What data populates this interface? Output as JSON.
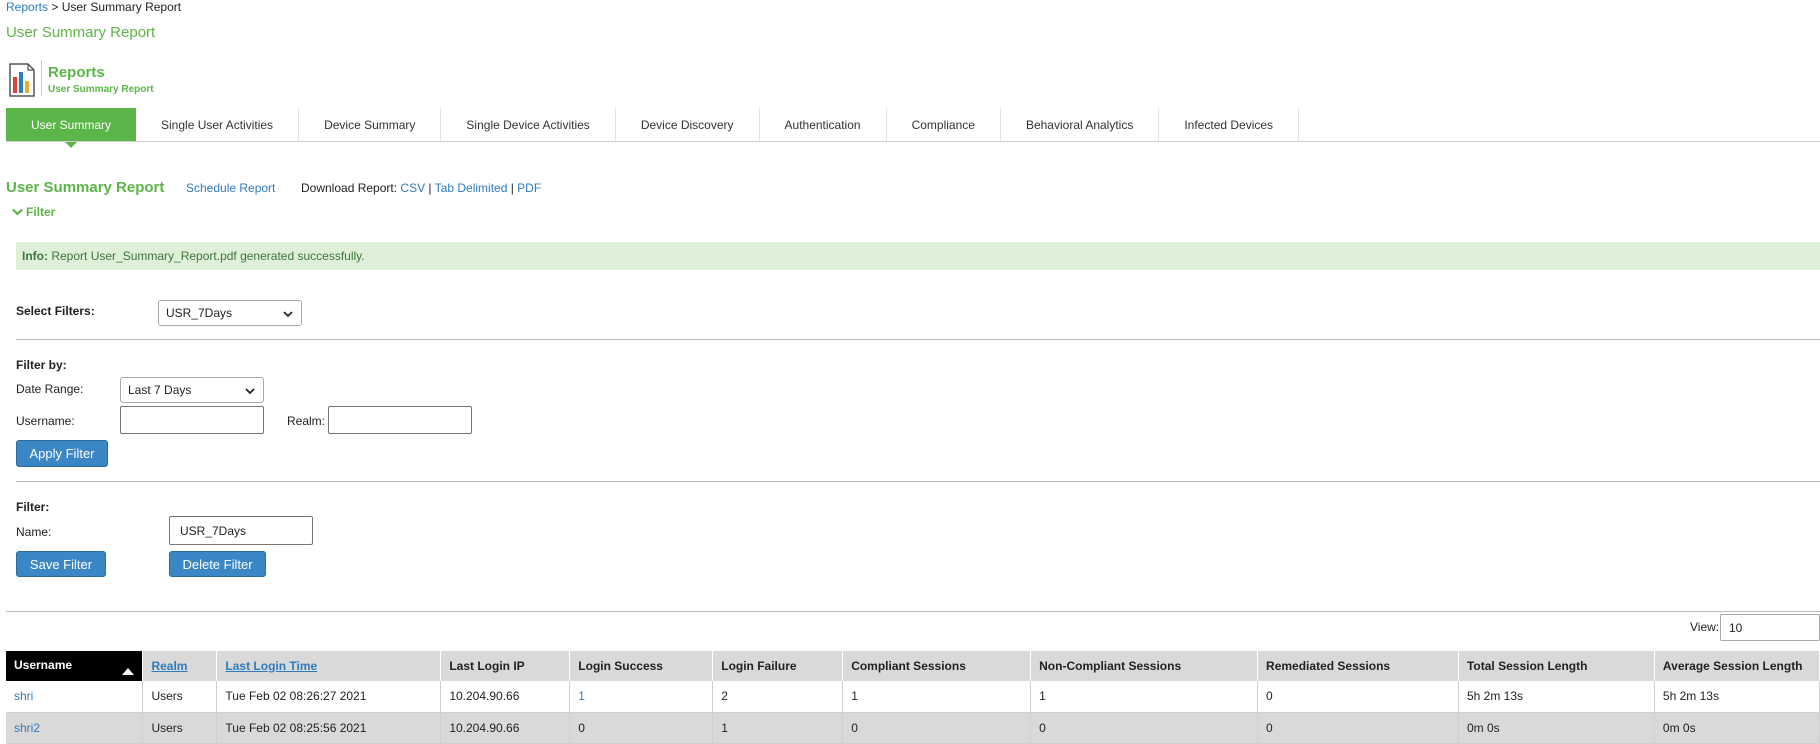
{
  "breadcrumb": {
    "root": "Reports",
    "separator": " > ",
    "current": "User Summary Report"
  },
  "page_title": "User Summary Report",
  "header": {
    "title": "Reports",
    "subtitle": "User Summary Report"
  },
  "tabs": [
    {
      "label": "User Summary",
      "active": true
    },
    {
      "label": "Single User Activities"
    },
    {
      "label": "Device Summary"
    },
    {
      "label": "Single Device Activities"
    },
    {
      "label": "Device Discovery"
    },
    {
      "label": "Authentication"
    },
    {
      "label": "Compliance"
    },
    {
      "label": "Behavioral Analytics"
    },
    {
      "label": "Infected Devices"
    }
  ],
  "section": {
    "title": "User Summary Report",
    "schedule_label": "Schedule Report",
    "download_label": "Download Report:",
    "csv": "CSV",
    "tab_delimited": "Tab Delimited",
    "pdf": "PDF",
    "pipe": " | ",
    "filter_toggle": "Filter"
  },
  "info": {
    "prefix": "Info:",
    "message": "Report User_Summary_Report.pdf generated successfully."
  },
  "select_filters": {
    "label": "Select Filters:",
    "value": "USR_7Days"
  },
  "filter_by": {
    "heading": "Filter by:",
    "date_range_label": "Date Range:",
    "date_range_value": "Last 7 Days",
    "username_label": "Username:",
    "username_value": "",
    "realm_label": "Realm:",
    "realm_value": "",
    "apply_label": "Apply Filter"
  },
  "filter_save": {
    "heading": "Filter:",
    "name_label": "Name:",
    "name_value": "USR_7Days",
    "save_label": "Save Filter",
    "delete_label": "Delete Filter"
  },
  "view": {
    "label": "View:",
    "value": "10"
  },
  "table": {
    "columns": [
      "Username",
      "Realm",
      "Last Login Time",
      "Last Login IP",
      "Login Success",
      "Login Failure",
      "Compliant Sessions",
      "Non-Compliant Sessions",
      "Remediated Sessions",
      "Total Session Length",
      "Average Session Length"
    ],
    "rows": [
      [
        "shri",
        "Users",
        "Tue Feb 02 08:26:27 2021",
        "10.204.90.66",
        "1",
        "2",
        "1",
        "1",
        "0",
        "5h 2m 13s",
        "5h 2m 13s"
      ],
      [
        "shri2",
        "Users",
        "Tue Feb 02 08:25:56 2021",
        "10.204.90.66",
        "0",
        "1",
        "0",
        "0",
        "0",
        "0m 0s",
        "0m 0s"
      ]
    ]
  },
  "colors": {
    "brand_green": "#5cb548",
    "link_blue": "#2f7bbf",
    "button_blue": "#3b87c6",
    "info_bg": "#dff0d8"
  }
}
